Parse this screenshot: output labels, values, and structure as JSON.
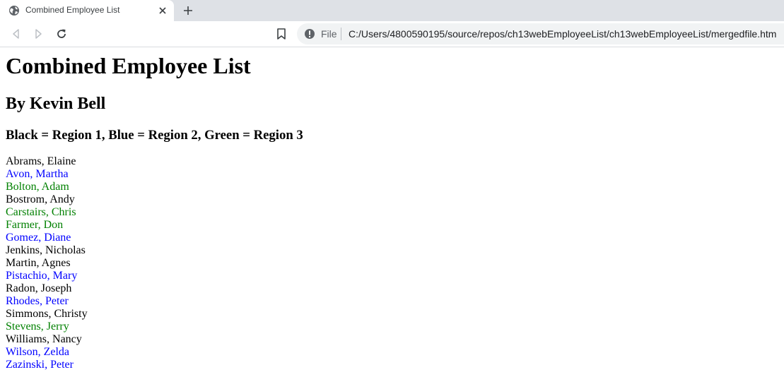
{
  "browser": {
    "tab_title": "Combined Employee List",
    "scheme_label": "File",
    "url": "C:/Users/4800590195/source/repos/ch13webEmployeeList/ch13webEmployeeList/mergedfile.htm"
  },
  "page": {
    "heading": "Combined Employee List",
    "author": "By Kevin Bell",
    "legend": "Black = Region 1, Blue = Region 2, Green = Region 3"
  },
  "region_colors": {
    "1": "#000000",
    "2": "#0000ff",
    "3": "#008000"
  },
  "employees": [
    {
      "name": "Abrams, Elaine",
      "region": 1
    },
    {
      "name": "Avon, Martha",
      "region": 2
    },
    {
      "name": "Bolton, Adam",
      "region": 3
    },
    {
      "name": "Bostrom, Andy",
      "region": 1
    },
    {
      "name": "Carstairs, Chris",
      "region": 3
    },
    {
      "name": "Farmer, Don",
      "region": 3
    },
    {
      "name": "Gomez, Diane",
      "region": 2
    },
    {
      "name": "Jenkins, Nicholas",
      "region": 1
    },
    {
      "name": "Martin, Agnes",
      "region": 1
    },
    {
      "name": "Pistachio, Mary",
      "region": 2
    },
    {
      "name": "Radon, Joseph",
      "region": 1
    },
    {
      "name": "Rhodes, Peter",
      "region": 2
    },
    {
      "name": "Simmons, Christy",
      "region": 1
    },
    {
      "name": "Stevens, Jerry",
      "region": 3
    },
    {
      "name": "Williams, Nancy",
      "region": 1
    },
    {
      "name": "Wilson, Zelda",
      "region": 2
    },
    {
      "name": "Zazinski, Peter",
      "region": 2
    }
  ]
}
